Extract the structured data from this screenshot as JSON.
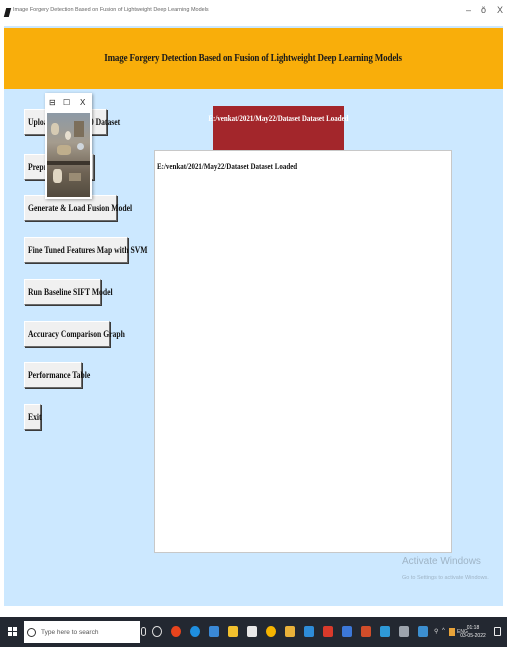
{
  "window": {
    "title": "Image Forgery Detection Based on Fusion of Lightweight Deep Learning Models",
    "minimize": "–",
    "maximize": "ŏ",
    "close": "X"
  },
  "header": {
    "title": "Image Forgery Detection Based on Fusion of Lightweight Deep Learning Models",
    "background": "#f9ae0a"
  },
  "sidebar": {
    "buttons": [
      {
        "label": "Upload MICC-F220 Dataset"
      },
      {
        "label": "Preprocess Dataset"
      },
      {
        "label": "Generate & Load Fusion Model"
      },
      {
        "label": "Fine Tuned Features Map with SVM"
      },
      {
        "label": "Run Baseline SIFT Model"
      },
      {
        "label": "Accuracy Comparison Graph"
      },
      {
        "label": "Performance Table"
      },
      {
        "label": "Exit"
      }
    ]
  },
  "status": {
    "label": "E:/venkat/2021/May22/Dataset Dataset Loaded",
    "background": "#a3262b"
  },
  "output": {
    "text": "E:/venkat/2021/May22/Dataset Dataset Loaded"
  },
  "popup": {
    "restore": "⊟",
    "maximize": "☐",
    "close": "X"
  },
  "watermark": {
    "line1": "Activate Windows",
    "line2": "Go to Settings to activate Windows."
  },
  "taskbar": {
    "search_placeholder": "Type here to search",
    "tray_icons": [
      "people-icon",
      "chevron-up-icon",
      "network-icon",
      "volume-icon"
    ],
    "language": "ENG",
    "time": "01:18",
    "date": "03-05-2022"
  },
  "colors": {
    "client_bg": "#cce8ff",
    "taskbar_bg": "#232831"
  }
}
